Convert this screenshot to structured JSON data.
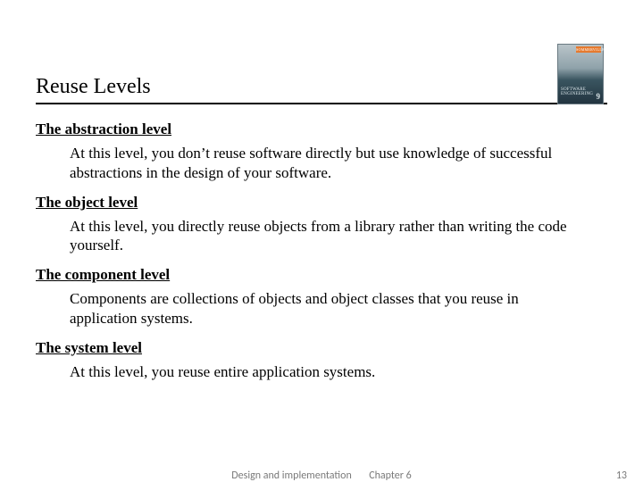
{
  "title": "Reuse Levels",
  "book": {
    "tab": "SOMMERVILLE",
    "label": "SOFTWARE ENGINEERING",
    "edition": "9"
  },
  "sections": [
    {
      "heading": "The abstraction level",
      "body": "At this level, you don’t reuse software directly but use knowledge of successful abstractions in the design of your software."
    },
    {
      "heading": "The object level",
      "body": "At this level, you directly reuse objects from a library rather than writing the code yourself."
    },
    {
      "heading": "The component level",
      "body": "Components are collections of objects and object classes that you reuse in application systems."
    },
    {
      "heading": "The system level",
      "body": "At this level, you reuse entire application systems."
    }
  ],
  "footer": {
    "left": "Design and implementation",
    "right": "Chapter 6",
    "page": "13"
  }
}
